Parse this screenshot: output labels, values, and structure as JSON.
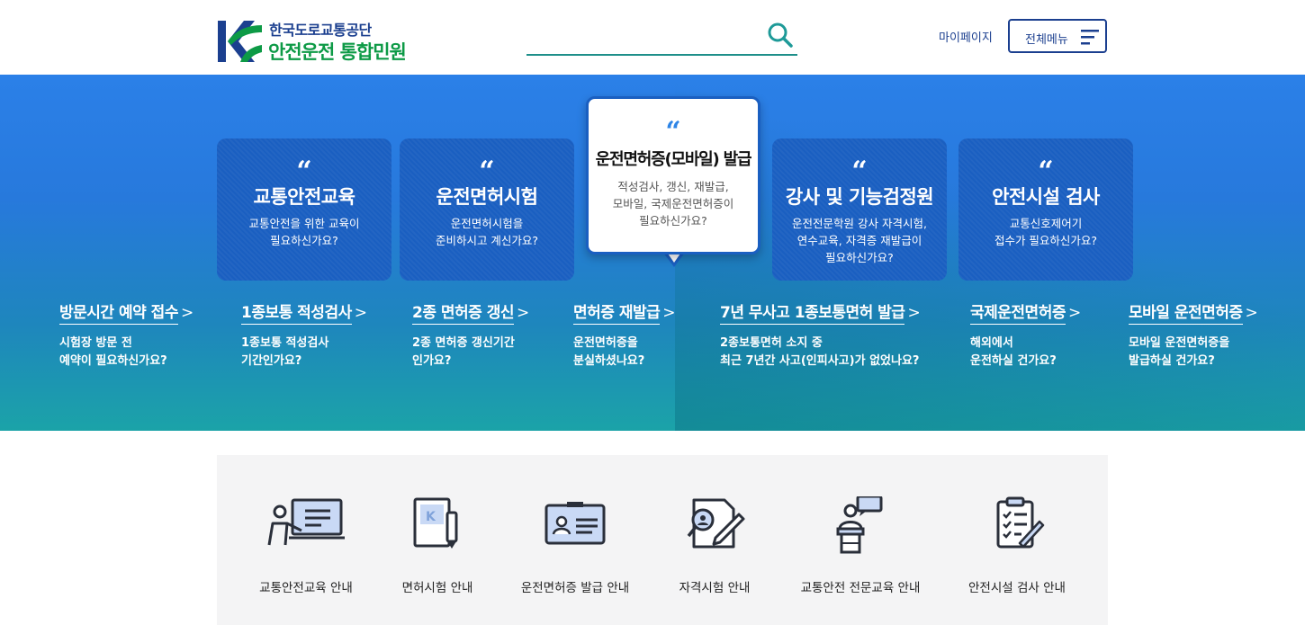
{
  "header": {
    "logo_org": "한국도로교통공단",
    "logo_name": "안전운전 통합민원",
    "search_placeholder": "",
    "mypage_label": "마이페이지",
    "allmenu_label": "전체메뉴"
  },
  "cards": [
    {
      "title": "교통안전교육",
      "desc": "교통안전을 위한 교육이\n필요하신가요?",
      "active": false
    },
    {
      "title": "운전면허시험",
      "desc": "운전면허시험을\n준비하시고 계신가요?",
      "active": false
    },
    {
      "title": "운전면허증(모바일) 발급",
      "desc": "적성검사, 갱신, 재발급,\n모바일, 국제운전면허증이\n필요하신가요?",
      "active": true
    },
    {
      "title": "강사 및 기능검정원",
      "desc": "운전전문학원 강사 자격시험,\n연수교육, 자격증 재발급이\n필요하신가요?",
      "active": false
    },
    {
      "title": "안전시설 검사",
      "desc": "교통신호제어기\n접수가 필요하신가요?",
      "active": false
    }
  ],
  "quick_links": [
    {
      "title": "방문시간 예약 접수",
      "desc": "시험장 방문 전\n예약이 필요하신가요?"
    },
    {
      "title": "1종보통 적성검사",
      "desc": "1종보통 적성검사\n기간인가요?"
    },
    {
      "title": "2종 면허증 갱신",
      "desc": "2종 면허증 갱신기간\n인가요?"
    },
    {
      "title": "면허증 재발급",
      "desc": "운전면허증을\n분실하셨나요?"
    },
    {
      "title": "7년 무사고 1종보통면허 발급",
      "desc": "2종보통면허 소지 중\n최근 7년간 사고(인피사고)가 없었나요?"
    },
    {
      "title": "국제운전면허증",
      "desc": "해외에서\n운전하실 건가요?"
    },
    {
      "title": "모바일 운전면허증",
      "desc": "모바일 운전면허증을\n발급하실 건가요?"
    }
  ],
  "services": [
    {
      "label": "교통안전교육 안내",
      "icon": "lecture-icon"
    },
    {
      "label": "면허시험 안내",
      "icon": "exam-book-icon"
    },
    {
      "label": "운전면허증 발급 안내",
      "icon": "license-card-icon"
    },
    {
      "label": "자격시험 안내",
      "icon": "certificate-icon"
    },
    {
      "label": "교통안전 전문교육 안내",
      "icon": "speaker-podium-icon"
    },
    {
      "label": "안전시설 검사 안내",
      "icon": "checklist-icon"
    }
  ],
  "colors": {
    "brand_navy": "#1b3f8f",
    "brand_green": "#0d9a46",
    "hero_blue": "#2b80e8",
    "card_blue": "#1a5fc1"
  }
}
